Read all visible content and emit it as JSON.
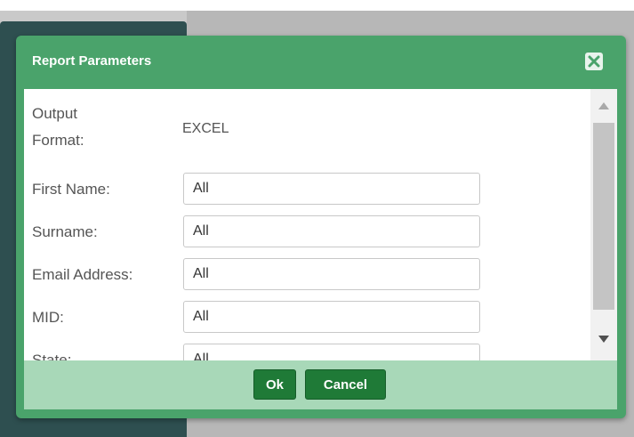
{
  "dialog": {
    "title": "Report Parameters",
    "close_icon": "close-x-icon"
  },
  "form": {
    "output_format": {
      "label_line1": "Output",
      "label_line2": "Format:",
      "value": "EXCEL"
    },
    "fields": [
      {
        "label": "First Name:",
        "value": "All"
      },
      {
        "label": "Surname:",
        "value": "All"
      },
      {
        "label": "Email Address:",
        "value": "All"
      },
      {
        "label": "MID:",
        "value": "All"
      },
      {
        "label": "State:",
        "value": "All"
      }
    ]
  },
  "scrollbar": {
    "up_icon": "triangle-up-icon",
    "down_icon": "triangle-down-icon"
  },
  "footer": {
    "ok_label": "Ok",
    "cancel_label": "Cancel"
  },
  "colors": {
    "header_green": "#4aa36b",
    "footer_green": "#a8d8b8",
    "button_green": "#1f7a37",
    "backdrop_dark": "#2e4f50"
  }
}
